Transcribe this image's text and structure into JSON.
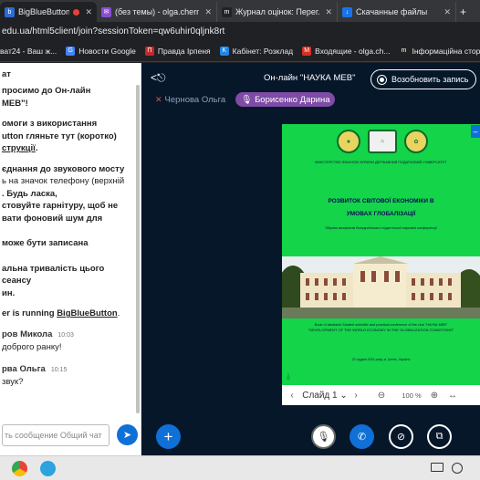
{
  "browser": {
    "tabs": [
      {
        "title": "BigBlueButton - Он-л",
        "recording": true,
        "active": true
      },
      {
        "title": "(без темы) - olga.chernov"
      },
      {
        "title": "Журнал оцінок: Перегляд"
      },
      {
        "title": "Скачанные файлы"
      }
    ],
    "url": "edu.ua/html5client/join?sessionToken=qw6uhir0qljnk8rt",
    "bookmarks": [
      {
        "label": "ват24 - Ваш ж..."
      },
      {
        "label": "Новости Google"
      },
      {
        "label": "Правда Ірпеня"
      },
      {
        "label": "Кабінет: Розклад"
      },
      {
        "label": "Входящие - olga.ch..."
      },
      {
        "label": "Інформаційна стор..."
      }
    ]
  },
  "chat": {
    "header": "ат",
    "welcome_1_pre": "просимо до ",
    "welcome_1_bold": "Он-лайн",
    "welcome_1_bold2": "МЕВ\"",
    "welcome_1_post": "!",
    "help_line1": "омоги з використання",
    "help_line2": "utton гляньте тут (коротко)",
    "help_link": "струкції",
    "help_post": ".",
    "audio_line1": "єднання до звукового мосту",
    "audio_line2": "ь на значок телефону (верхній",
    "audio_bold1": ". Будь ласка,",
    "audio_bold2": "стовуйте гарнітуру, щоб не",
    "audio_bold3": "вати фоновий шум для",
    "record_note": "може бути записана",
    "duration_line1": "альна тривалість цього сеансу",
    "duration_line2": "ин.",
    "running_pre": "er is running ",
    "running_link": "BigBlueButton",
    "running_post": ".",
    "messages": [
      {
        "name": "ров Микола",
        "time": "10:03",
        "text": "доброго ранку!"
      },
      {
        "name": "рва Ольга",
        "time": "10:15",
        "text": "звук?"
      }
    ],
    "input_placeholder": "ть сообщение Общий чат"
  },
  "meeting": {
    "title": "Он-лайн \"НАУКА МЕВ\"",
    "record_label": "Возобновить запись",
    "talkers": [
      {
        "name": "Чернова Ольга",
        "muted": true
      },
      {
        "name": "Борисенко Дарина",
        "muted": false
      }
    ]
  },
  "slide": {
    "header": "МІНІСТЕРСТВО ФІНАНСІВ УКРАЇНИ ДЕРЖАВНИЙ ПОДАТКОВИЙ УНІВЕРСИТЕТ",
    "title_line1": "РОЗВИТОК СВІТОВОЇ ЕКОНОМІКИ В",
    "title_line2": "УМОВАХ ГЛОБАЛІЗАЦІЇ",
    "subtitle": "Збірник матеріалів Всеукраїнської студентської наукової конференції",
    "eng_intro": "Book of abstracts Student scientific and practical conference of the club \"НАУКА МЕВ\"",
    "eng_title": "\"DEVELOPMENT OF THE WORLD ECONOMY IN THE GLOBALIZATION CONDITIONS\"",
    "date": "22 грудня 2021 року, м. Ірпінь, Україна",
    "page_label": "Слайд 1",
    "zoom": "100 %"
  }
}
